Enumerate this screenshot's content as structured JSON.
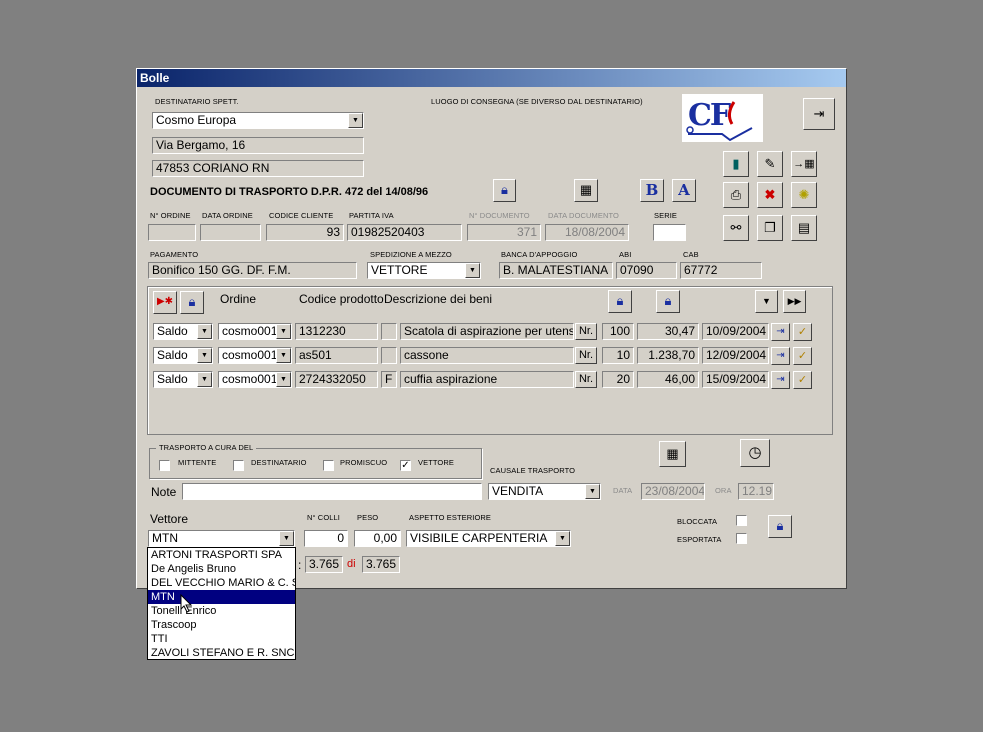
{
  "window": {
    "title": "Bolle"
  },
  "dest": {
    "label": "DESTINATARIO SPETT.",
    "name": "Cosmo Europa",
    "address": "Via Bergamo, 16",
    "city": "47853 CORIANO RN"
  },
  "luogo_label": "LUOGO DI CONSEGNA (SE DIVERSO DAL DESTINATARIO)",
  "doc_title": "DOCUMENTO DI TRASPORTO D.P.R. 472 del 14/08/96",
  "logo_text": "CF",
  "order": {
    "labels": {
      "n_ordine": "N° ORDINE",
      "data_ordine": "DATA ORDINE",
      "codice_cliente": "CODICE CLIENTE",
      "partita_iva": "PARTITA IVA",
      "n_documento": "N° DOCUMENTO",
      "data_documento": "DATA DOCUMENTO",
      "serie": "SERIE"
    },
    "n_ordine": "",
    "data_ordine": "",
    "codice_cliente": "93",
    "partita_iva": "01982520403",
    "n_documento": "371",
    "data_documento": "18/08/2004",
    "serie": ""
  },
  "pay": {
    "labels": {
      "pagamento": "PAGAMENTO",
      "spedizione": "SPEDIZIONE A MEZZO",
      "banca": "BANCA D'APPOGGIO",
      "abi": "ABI",
      "cab": "CAB"
    },
    "pagamento": "Bonifico 150 GG. DF. F.M.",
    "spedizione": "VETTORE",
    "banca": "B. MALATESTIANA",
    "abi": "07090",
    "cab": "67772"
  },
  "items": {
    "headers": {
      "ordine": "Ordine",
      "codice": "Codice prodotto",
      "descrizione": "Descrizione dei beni"
    },
    "rows": [
      {
        "tipo": "Saldo",
        "ordine": "cosmo001",
        "codice": "1312230",
        "flag": "",
        "desc": "Scatola di aspirazione per utensile c",
        "um": "Nr.",
        "qta": "100",
        "prezzo": "30,47",
        "data": "10/09/2004"
      },
      {
        "tipo": "Saldo",
        "ordine": "cosmo001",
        "codice": "as501",
        "flag": "",
        "desc": "cassone",
        "um": "Nr.",
        "qta": "10",
        "prezzo": "1.238,70",
        "data": "12/09/2004"
      },
      {
        "tipo": "Saldo",
        "ordine": "cosmo001",
        "codice": "2724332050",
        "flag": "F",
        "desc": "cuffia aspirazione",
        "um": "Nr.",
        "qta": "20",
        "prezzo": "46,00",
        "data": "15/09/2004"
      }
    ]
  },
  "transport": {
    "group_label": "TRASPORTO A CURA DEL",
    "mittente": "MITTENTE",
    "destinatario": "DESTINATARIO",
    "promiscuo": "PROMISCUO",
    "vettore": "VETTORE",
    "vettore_checked": "✓",
    "causale_label": "CAUSALE TRASPORTO",
    "causale": "VENDITA",
    "data_label": "DATA",
    "data": "23/08/2004",
    "ora_label": "ORA",
    "ora": "12.19"
  },
  "note": {
    "label": "Note",
    "value": ""
  },
  "carrier": {
    "label": "Vettore",
    "value": "MTN",
    "colli_label": "N° COLLI",
    "colli": "0",
    "peso_label": "PESO",
    "peso": "0,00",
    "aspetto_label": "ASPETTO ESTERIORE",
    "aspetto": "VISIBILE CARPENTERIA",
    "bloccata_label": "BLOCCATA",
    "esportata_label": "ESPORTATA",
    "page_prefix": ":",
    "page_current": "3.765",
    "page_of": "di",
    "page_total": "3.765",
    "options": [
      "ARTONI TRASPORTI SPA",
      "De Angelis Bruno",
      "DEL VECCHIO MARIO & C. SNC",
      "MTN",
      "Tonelli Enrico",
      "Trascoop",
      "TTI",
      "ZAVOLI STEFANO E R. SNC"
    ],
    "selected_index": 3
  },
  "colors": {
    "title_start": "#0a246a",
    "title_end": "#a6caf0",
    "selection": "#000080",
    "accent_blue": "#1a2fa0",
    "accent_red": "#cc0000"
  },
  "icons": [
    "exit-icon",
    "lock-icon",
    "calculator-icon",
    "bold-b-icon",
    "font-a-icon",
    "book-icon",
    "edit-icon",
    "insert-icon",
    "print-icon",
    "delete-icon",
    "light-icon",
    "binoculars-icon",
    "copy-icon",
    "card-icon",
    "new-row-icon",
    "arrow-down-icon",
    "arrow-end-icon",
    "goto-icon",
    "check-icon",
    "clock-icon"
  ]
}
